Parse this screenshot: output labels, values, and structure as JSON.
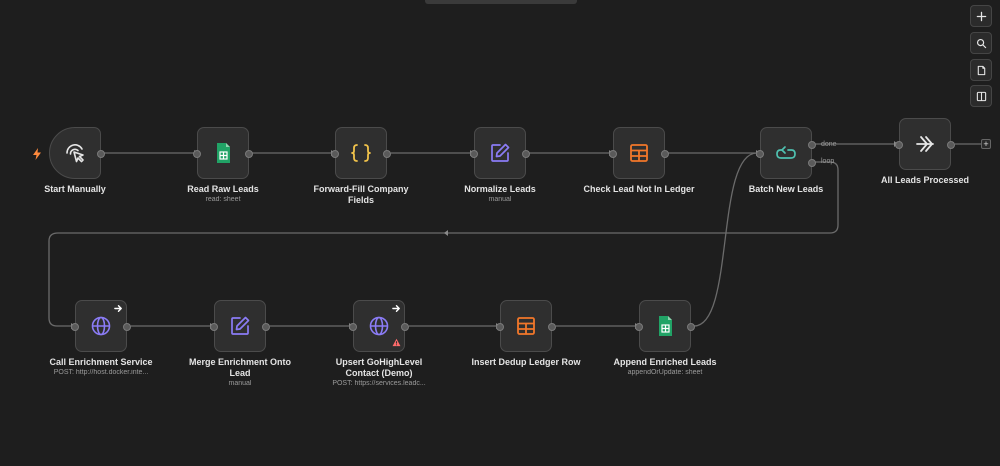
{
  "nodes": [
    {
      "id": "start",
      "label": "Start Manually",
      "subtitle": "",
      "icon": "cursor-click-icon"
    },
    {
      "id": "read",
      "label": "Read Raw Leads",
      "subtitle": "read: sheet",
      "icon": "google-sheets-icon"
    },
    {
      "id": "ffill",
      "label": "Forward-Fill Company Fields",
      "subtitle": "",
      "icon": "code-braces-icon"
    },
    {
      "id": "norm",
      "label": "Normalize Leads",
      "subtitle": "manual",
      "icon": "edit-pencil-icon"
    },
    {
      "id": "check",
      "label": "Check Lead Not In Ledger",
      "subtitle": "",
      "icon": "table-icon"
    },
    {
      "id": "batch",
      "label": "Batch New Leads",
      "subtitle": "",
      "icon": "loop-icon"
    },
    {
      "id": "done",
      "label": "All Leads Processed",
      "subtitle": "",
      "icon": "double-chevron-right-icon"
    },
    {
      "id": "call",
      "label": "Call Enrichment Service",
      "subtitle": "POST: http://host.docker.inte...",
      "icon": "globe-icon"
    },
    {
      "id": "merge",
      "label": "Merge Enrichment Onto Lead",
      "subtitle": "manual",
      "icon": "edit-pencil-icon"
    },
    {
      "id": "upsert",
      "label": "Upsert GoHighLevel Contact (Demo)",
      "subtitle": "POST: https://services.leadc...",
      "icon": "globe-icon"
    },
    {
      "id": "insert",
      "label": "Insert Dedup Ledger Row",
      "subtitle": "",
      "icon": "table-icon"
    },
    {
      "id": "append",
      "label": "Append Enriched Leads",
      "subtitle": "appendOrUpdate: sheet",
      "icon": "google-sheets-icon"
    }
  ],
  "batch_ports": {
    "done": "done",
    "loop": "loop"
  },
  "controls": [
    {
      "name": "zoom-in-button",
      "icon": "plus-icon"
    },
    {
      "name": "search-button",
      "icon": "search-icon"
    },
    {
      "name": "sticky-note-button",
      "icon": "note-icon"
    },
    {
      "name": "panel-toggle-button",
      "icon": "sidebar-icon"
    }
  ],
  "colors": {
    "background": "#1e1e1e",
    "node_bg": "#2f2f2f",
    "node_border": "#4b4b4b",
    "wire": "#6b6b6b",
    "sheets_green": "#21a366",
    "code_yellow": "#f0c24b",
    "purple": "#8b7cf6",
    "orange": "#f2772a",
    "teal": "#4fc1b0",
    "warning_red": "#ff6b6b",
    "trigger_bolt": "#ff8a3d"
  }
}
